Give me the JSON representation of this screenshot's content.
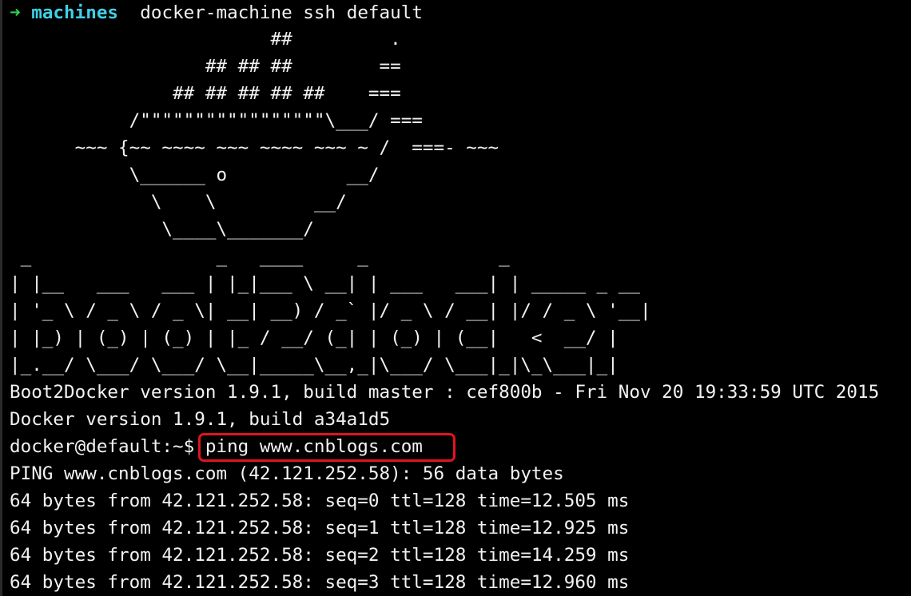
{
  "shell_prompt": {
    "arrow": "➜",
    "directory": "machines",
    "command": "docker-machine ssh default"
  },
  "ascii_art": [
    "                        ##         .",
    "                  ## ## ##        ==",
    "               ## ## ## ## ##    ===",
    "           /\"\"\"\"\"\"\"\"\"\"\"\"\"\"\"\"\"\\___/ ===",
    "      ~~~ {~~ ~~~~ ~~~ ~~~~ ~~~ ~ /  ===- ~~~",
    "           \\______ o           __/",
    "             \\    \\         __/",
    "              \\____\\_______/",
    " _                 _   ____     _            _",
    "| |__   ___   ___ | |_|___ \\ __| | ___   ___| | _____ _ __",
    "| '_ \\ / _ \\ / _ \\| __| __) / _` |/ _ \\ / __| |/ / _ \\ '__|",
    "| |_) | (_) | (_) | |_ / __/ (_| | (_) | (__|   <  __/ |",
    "|_.__/ \\___/ \\___/ \\__|_____\\__,_|\\___/ \\___|_|\\_\\___|_|"
  ],
  "output": {
    "boot2docker_version": "Boot2Docker version 1.9.1, build master : cef800b - Fri Nov 20 19:33:59 UTC 2015",
    "docker_version": "Docker version 1.9.1, build a34a1d5",
    "remote_prompt": "docker@default:~$",
    "remote_command": "ping www.cnblogs.com",
    "ping_header": "PING www.cnblogs.com (42.121.252.58): 56 data bytes",
    "ping_replies": [
      "64 bytes from 42.121.252.58: seq=0 ttl=128 time=12.505 ms",
      "64 bytes from 42.121.252.58: seq=1 ttl=128 time=12.925 ms",
      "64 bytes from 42.121.252.58: seq=2 ttl=128 time=14.259 ms",
      "64 bytes from 42.121.252.58: seq=3 ttl=128 time=12.960 ms"
    ]
  },
  "colors": {
    "background": "#000000",
    "text": "#f2f2f2",
    "prompt_arrow": "#2fd14f",
    "prompt_directory": "#3fd0e6",
    "annotation_box": "#e0141e"
  }
}
